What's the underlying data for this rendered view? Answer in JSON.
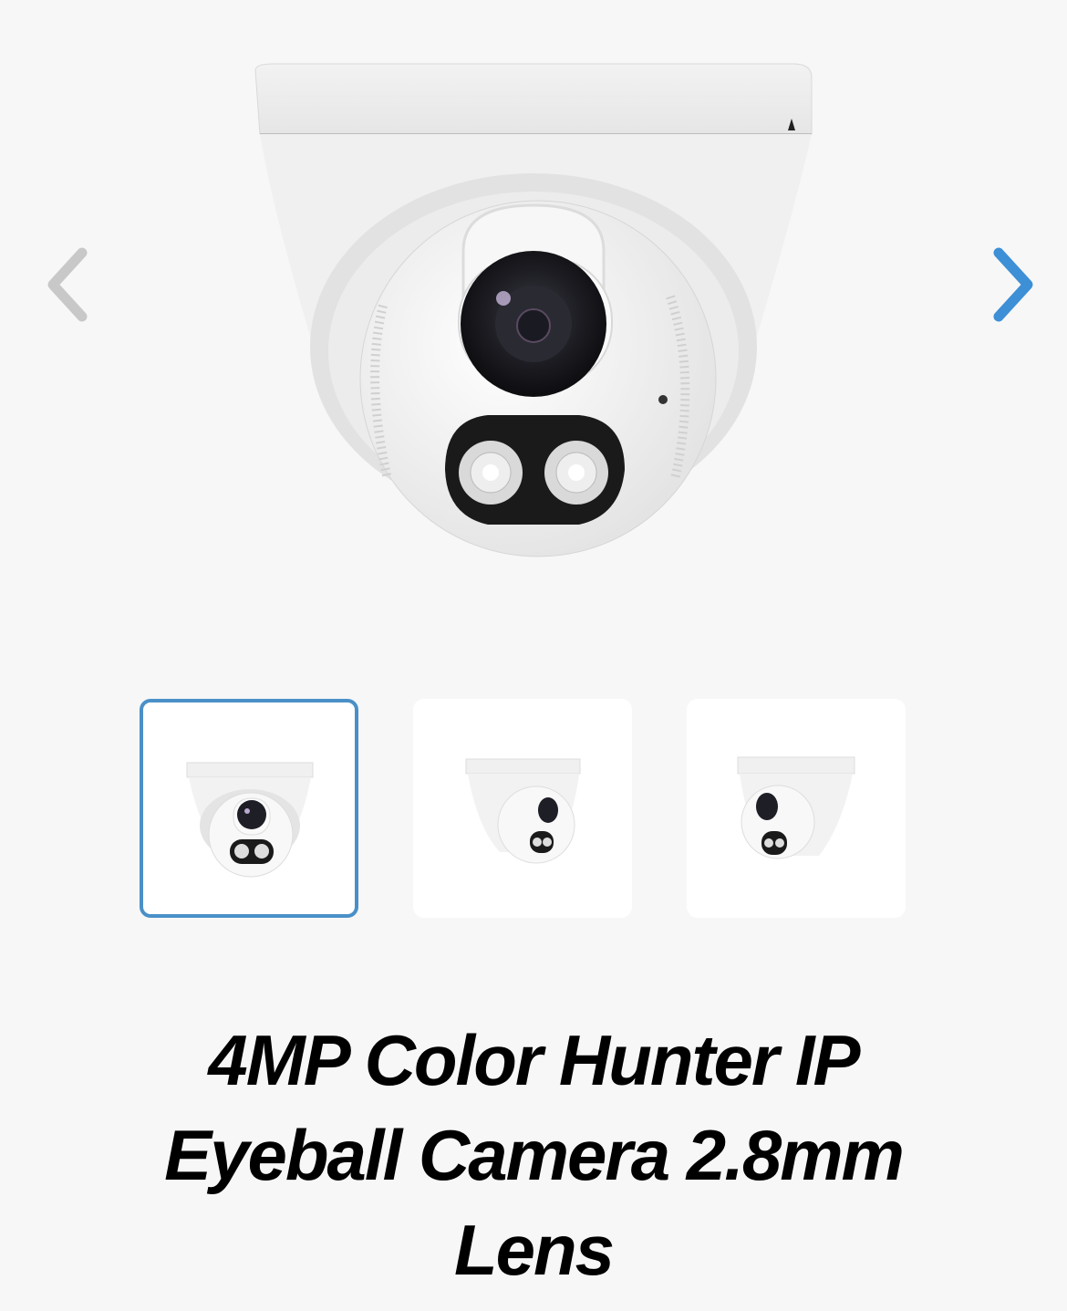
{
  "gallery": {
    "main_image": {
      "name": "camera-front-view",
      "alt": "4MP Color Hunter IP Eyeball Camera front view"
    },
    "prev_icon": "chevron-left-icon",
    "next_icon": "chevron-right-icon",
    "colors": {
      "prev_arrow": "#c8c8c8",
      "next_arrow": "#3d8fd6",
      "active_border": "#4a90c8"
    },
    "thumbnails": [
      {
        "view": "front",
        "active": true
      },
      {
        "view": "side-right",
        "active": false
      },
      {
        "view": "side-left",
        "active": false
      }
    ]
  },
  "product": {
    "title_lines": [
      "4MP Color Hunter IP",
      "Eyeball Camera 2.8mm",
      "Lens"
    ]
  }
}
